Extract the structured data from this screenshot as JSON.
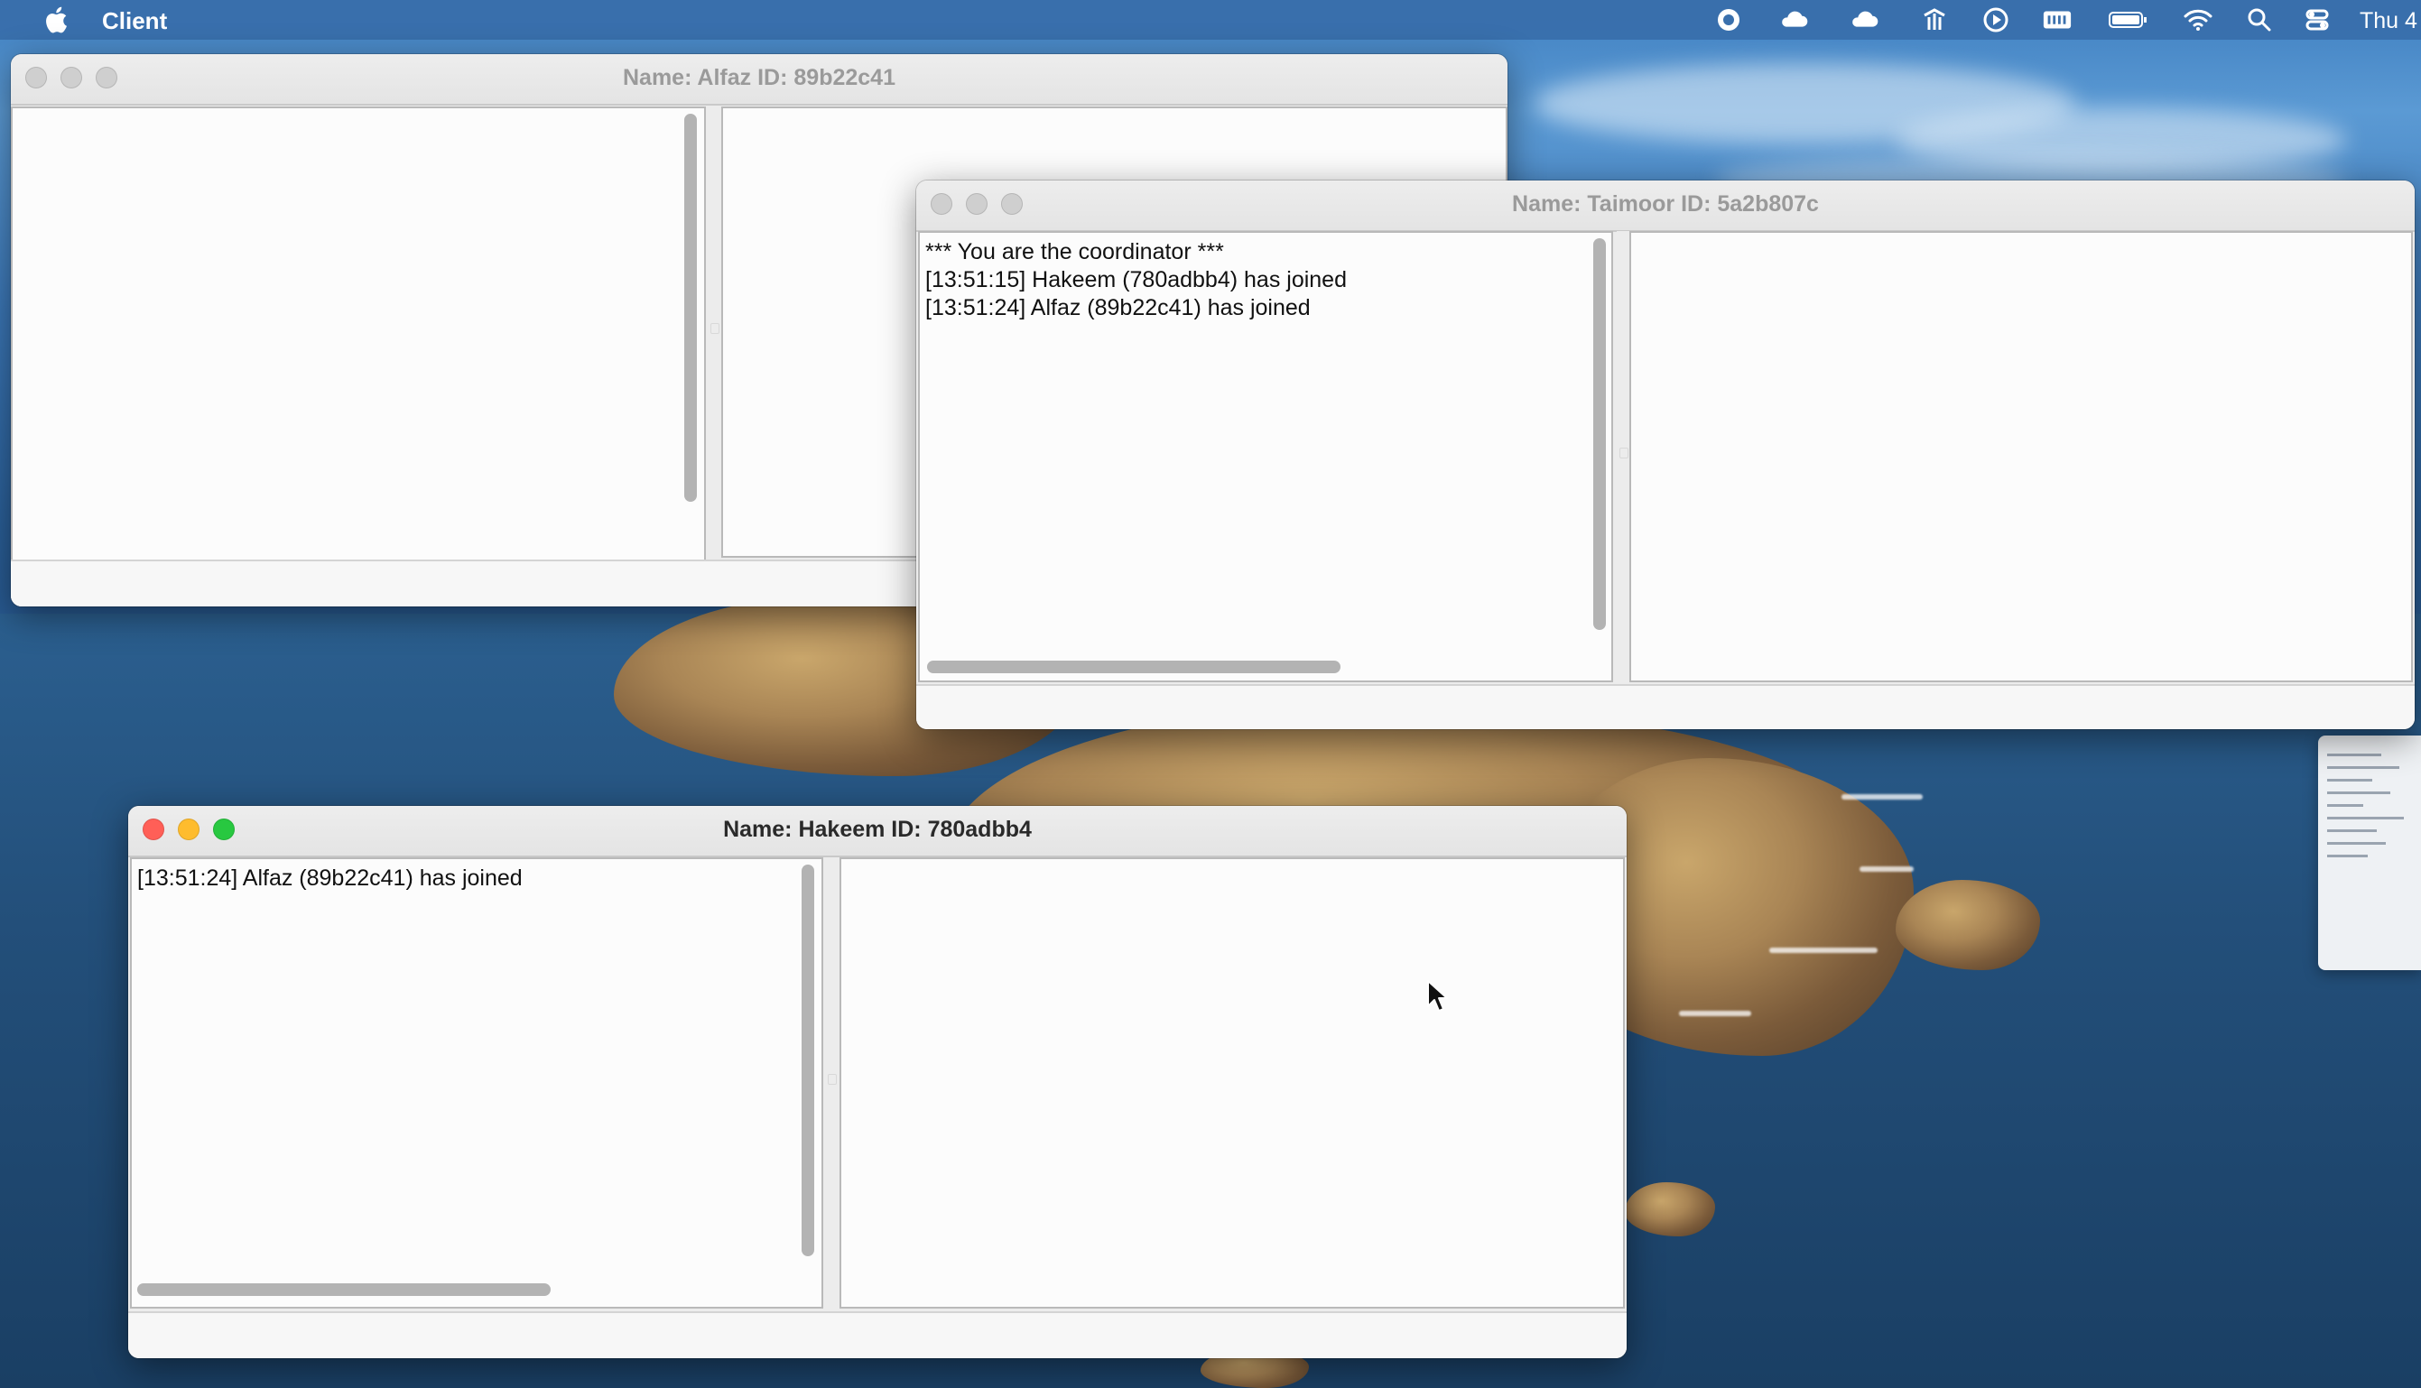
{
  "menubar": {
    "apple_icon": "apple-icon",
    "app_name": "Client",
    "tray_icons": [
      "record-icon",
      "cloud-icon",
      "cloud-icon",
      "antenna-icon",
      "play-icon",
      "keyboard-icon",
      "battery-icon",
      "wifi-icon",
      "search-icon",
      "control-center-icon"
    ],
    "clock": "Thu 4"
  },
  "windows": {
    "alfaz": {
      "title": "Name: Alfaz  ID: 89b22c41",
      "messages": ""
    },
    "taimoor": {
      "title": "Name: Taimoor  ID: 5a2b807c",
      "messages": "*** You are the coordinator ***\n[13:51:15] Hakeem (780adbb4) has joined\n[13:51:24] Alfaz (89b22c41) has joined"
    },
    "hakeem": {
      "title": "Name: Hakeem  ID: 780adbb4",
      "messages": "[13:51:24] Alfaz (89b22c41) has joined"
    }
  },
  "colors": {
    "close": "#ff5f57",
    "minimize": "#febc2e",
    "maximize": "#28c840",
    "menubar": "#386eaa"
  }
}
